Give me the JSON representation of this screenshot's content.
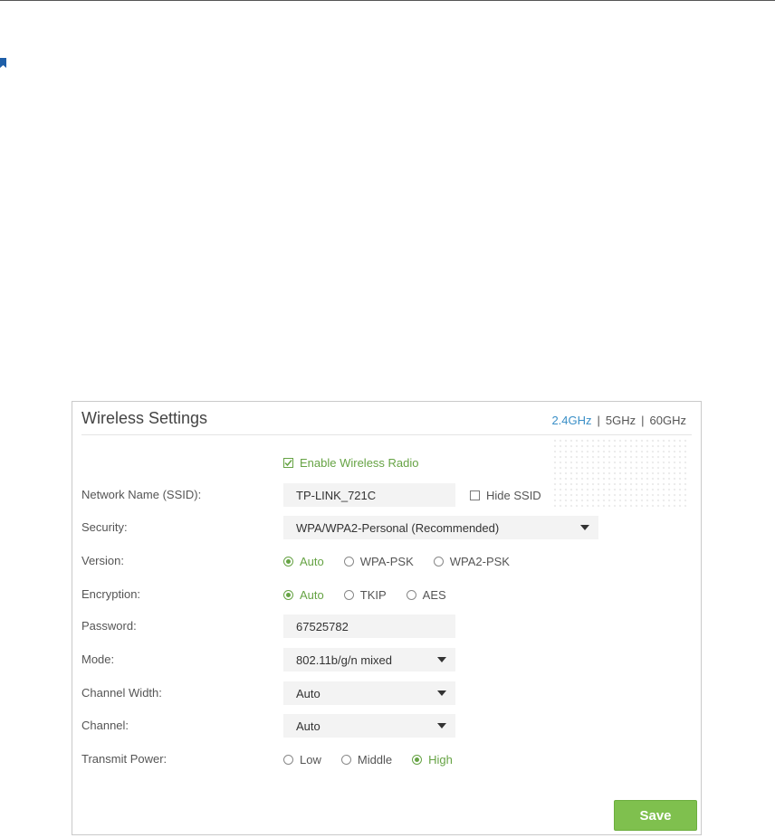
{
  "panel": {
    "title": "Wireless Settings",
    "bands": [
      {
        "label": "2.4GHz",
        "active": true
      },
      {
        "label": "5GHz",
        "active": false
      },
      {
        "label": "60GHz",
        "active": false
      }
    ],
    "separator": "|"
  },
  "enable_radio": {
    "label": "Enable Wireless Radio",
    "checked": true
  },
  "ssid": {
    "label": "Network Name (SSID):",
    "value": "TP-LINK_721C",
    "hide_label": "Hide SSID",
    "hide_checked": false
  },
  "security": {
    "label": "Security:",
    "value": "WPA/WPA2-Personal (Recommended)"
  },
  "version": {
    "label": "Version:",
    "options": [
      "Auto",
      "WPA-PSK",
      "WPA2-PSK"
    ],
    "selected": "Auto"
  },
  "encryption": {
    "label": "Encryption:",
    "options": [
      "Auto",
      "TKIP",
      "AES"
    ],
    "selected": "Auto"
  },
  "password": {
    "label": "Password:",
    "value": "67525782"
  },
  "mode": {
    "label": "Mode:",
    "value": "802.11b/g/n mixed"
  },
  "channel_width": {
    "label": "Channel Width:",
    "value": "Auto"
  },
  "channel": {
    "label": "Channel:",
    "value": "Auto"
  },
  "transmit_power": {
    "label": "Transmit Power:",
    "options": [
      "Low",
      "Middle",
      "High"
    ],
    "selected": "High"
  },
  "save_label": "Save",
  "colors": {
    "accent_green": "#66a344",
    "button_green": "#7fc04e",
    "link_blue": "#3a8fc7"
  }
}
